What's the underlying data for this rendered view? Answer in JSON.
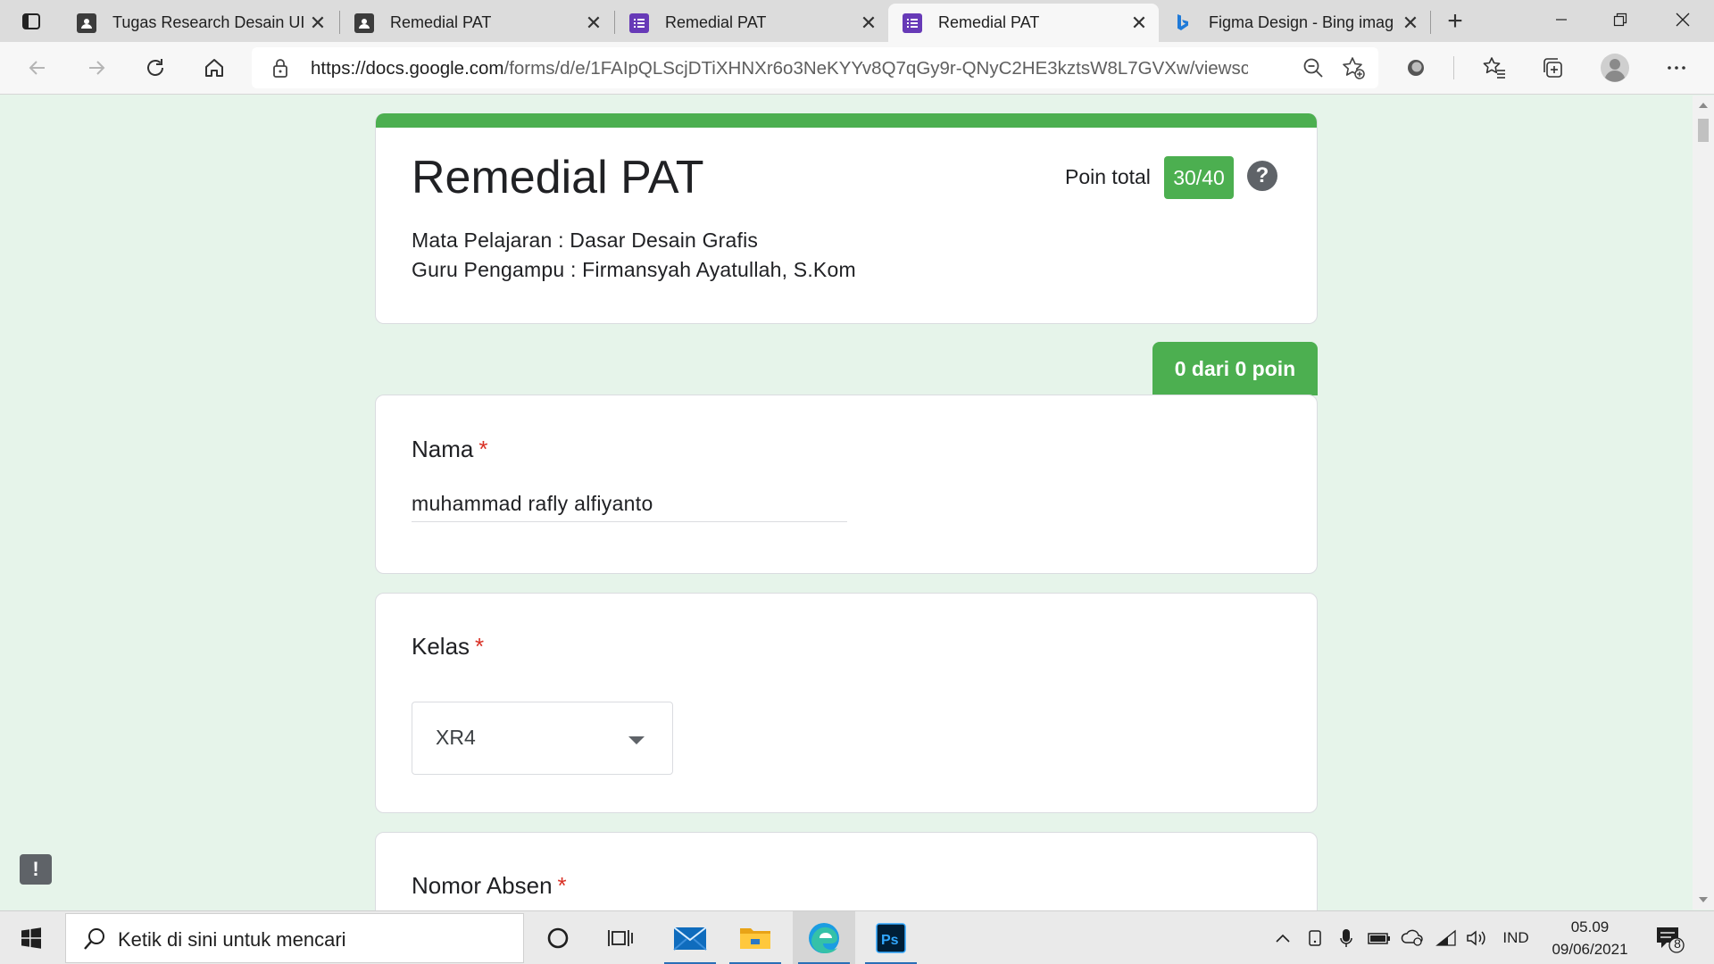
{
  "browser": {
    "tabs": [
      {
        "title": "Tugas Research Desain UI",
        "active": false,
        "icon": "person-page-icon"
      },
      {
        "title": "Remedial PAT",
        "active": false,
        "icon": "person-page-icon"
      },
      {
        "title": "Remedial PAT",
        "active": false,
        "icon": "google-forms-icon"
      },
      {
        "title": "Remedial PAT",
        "active": true,
        "icon": "google-forms-icon"
      },
      {
        "title": "Figma Design - Bing imag",
        "active": false,
        "icon": "bing-icon"
      }
    ],
    "url_host": "https://docs.google.com",
    "url_path": "/forms/d/e/1FAIpQLScjDTiXHNXr6o3NeKYYv8Q7qGy9r-QNyC2HE3kztsW8L7GVXw/viewsc..."
  },
  "form": {
    "title": "Remedial PAT",
    "points_label": "Poin total",
    "points_value": "30/40",
    "description": [
      "Mata Pelajaran : Dasar Desain Grafis",
      "Guru Pengampu : Firmansyah Ayatullah, S.Kom"
    ],
    "section_score": "0 dari 0 poin",
    "questions": [
      {
        "title": "Nama",
        "required_mark": "*",
        "answer": "muhammad rafly alfiyanto"
      },
      {
        "title": "Kelas",
        "required_mark": "*",
        "answer": "XR4"
      },
      {
        "title": "Nomor Absen",
        "required_mark": "*"
      }
    ],
    "accent_color": "#4caf50",
    "background_color": "#e6f4ea"
  },
  "taskbar": {
    "search_placeholder": "Ketik di sini untuk mencari",
    "language": "IND",
    "time": "05.09",
    "date": "09/06/2021",
    "notification_count": "8"
  }
}
